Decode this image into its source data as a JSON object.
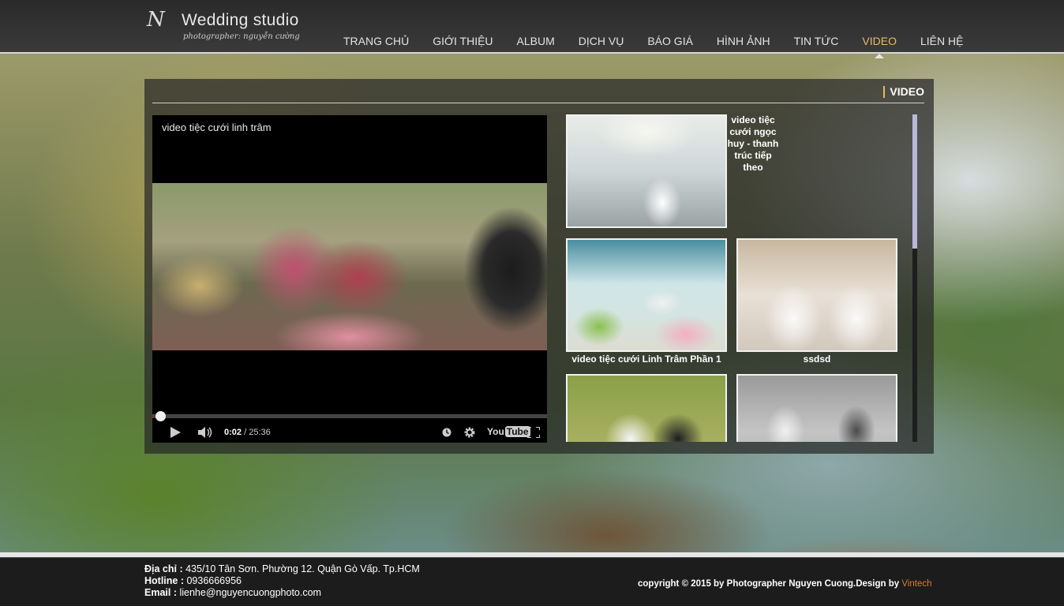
{
  "logo": {
    "mark": "N",
    "title": "Wedding studio",
    "subtitle": "photographer: nguyễn cường"
  },
  "nav": {
    "items": [
      {
        "label": "TRANG CHỦ"
      },
      {
        "label": "GIỚI THIỆU"
      },
      {
        "label": "ALBUM"
      },
      {
        "label": "DỊCH VỤ"
      },
      {
        "label": "BÁO GIÁ"
      },
      {
        "label": "HÌNH ẢNH"
      },
      {
        "label": "TIN TỨC"
      },
      {
        "label": "VIDEO"
      },
      {
        "label": "LIÊN HỆ"
      }
    ],
    "active": "VIDEO",
    "active_color": "#e8b964"
  },
  "panel": {
    "title": "VIDEO"
  },
  "player": {
    "title": "video tiệc cưới linh trâm",
    "time_current": "0:02",
    "time_separator": " / ",
    "time_total": "25:36",
    "progress_fraction": 0.0013,
    "icons": [
      "play-icon",
      "volume-icon",
      "watch-later-icon",
      "settings-gear-icon",
      "youtube-logo",
      "fullscreen-icon"
    ],
    "youtube_you": "You",
    "youtube_tube": "Tube"
  },
  "gallery": {
    "items": [
      {
        "caption": "video tiệc cưới ngọc huy - thanh trúc tiếp theo"
      },
      {
        "caption": "video tiệc cưới Linh Trâm Phần 1"
      },
      {
        "caption": "ssdsd"
      },
      {
        "caption": ""
      },
      {
        "caption": ""
      }
    ]
  },
  "footer": {
    "address_label": "Địa chỉ :",
    "address": " 435/10 Tân Sơn. Phường 12. Quận Gò Vấp. Tp.HCM",
    "hotline_label": "Hotline :",
    "hotline": " 0936666956",
    "email_label": "Email :",
    "email": " lienhe@nguyencuongphoto.com",
    "copyright": "copyright © 2015 by Photographer Nguyen Cuong.Design by ",
    "brand": "Vintech",
    "brand_color": "#e0782e"
  }
}
